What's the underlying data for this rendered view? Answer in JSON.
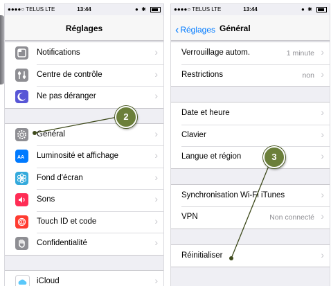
{
  "left": {
    "status": {
      "carrier": "●●●●○ TELUS  LTE",
      "time": "13:44"
    },
    "title": "Réglages",
    "groups": [
      [
        {
          "label": "Notifications",
          "icon": "notifications-icon",
          "color": "#8e8e93"
        },
        {
          "label": "Centre de contrôle",
          "icon": "control-center-icon",
          "color": "#8e8e93"
        },
        {
          "label": "Ne pas déranger",
          "icon": "moon-icon",
          "color": "#5856d6"
        }
      ],
      [
        {
          "label": "Général",
          "icon": "gear-icon",
          "color": "#8e8e93"
        },
        {
          "label": "Luminosité et affichage",
          "icon": "brightness-icon",
          "color": "#007aff"
        },
        {
          "label": "Fond d'écran",
          "icon": "wallpaper-icon",
          "color": "#34aadc"
        },
        {
          "label": "Sons",
          "icon": "sound-icon",
          "color": "#ff2d55"
        },
        {
          "label": "Touch ID et code",
          "icon": "fingerprint-icon",
          "color": "#ff3b30"
        },
        {
          "label": "Confidentialité",
          "icon": "hand-icon",
          "color": "#8e8e93"
        }
      ],
      [
        {
          "label": "iCloud",
          "icon": "cloud-icon",
          "color": "#ffffff"
        }
      ]
    ]
  },
  "right": {
    "status": {
      "carrier": "●●●●○ TELUS  LTE",
      "time": "13:44"
    },
    "back": "Réglages",
    "title": "Général",
    "groups": [
      [
        {
          "label": "Verrouillage autom.",
          "value": "1 minute"
        },
        {
          "label": "Restrictions",
          "value": "non"
        }
      ],
      [
        {
          "label": "Date et heure",
          "value": ""
        },
        {
          "label": "Clavier",
          "value": ""
        },
        {
          "label": "Langue et région",
          "value": ""
        }
      ],
      [
        {
          "label": "Synchronisation Wi-Fi iTunes",
          "value": ""
        },
        {
          "label": "VPN",
          "value": "Non connecté"
        }
      ],
      [
        {
          "label": "Réinitialiser",
          "value": ""
        }
      ]
    ]
  },
  "annotations": [
    {
      "number": "2"
    },
    {
      "number": "3"
    }
  ],
  "colors": {
    "badge": "#6b7f3a",
    "link": "#007aff"
  }
}
